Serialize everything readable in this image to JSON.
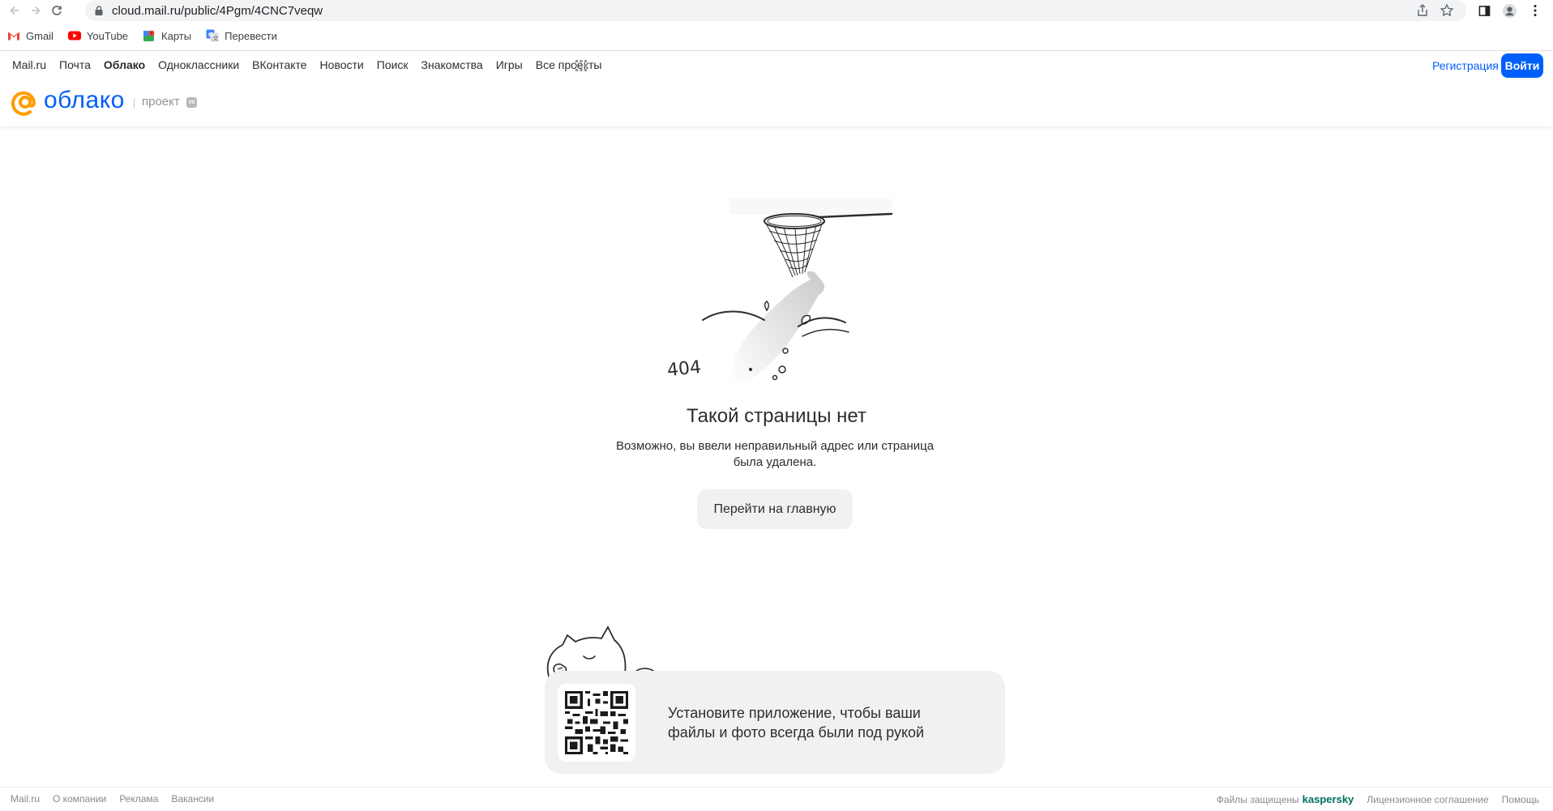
{
  "browser": {
    "url": "cloud.mail.ru/public/4Pgm/4CNC7veqw",
    "bookmarks": [
      {
        "label": "Gmail",
        "icon": "gmail-icon"
      },
      {
        "label": "YouTube",
        "icon": "youtube-icon"
      },
      {
        "label": "Карты",
        "icon": "maps-icon"
      },
      {
        "label": "Перевести",
        "icon": "translate-icon"
      }
    ]
  },
  "portal": {
    "links": [
      "Mail.ru",
      "Почта",
      "Облако",
      "Одноклассники",
      "ВКонтакте",
      "Новости",
      "Поиск",
      "Знакомства",
      "Игры",
      "Все проекты"
    ],
    "active": "Облако",
    "register_label": "Регистрация",
    "login_label": "Войти"
  },
  "cloud_header": {
    "logo_text": "облако",
    "project_label": "проект",
    "vk_badge": "VK"
  },
  "error": {
    "code_label": "404",
    "title": "Такой страницы нет",
    "description": "Возможно, вы ввели неправильный адрес или страница была удалена.",
    "home_button": "Перейти на главную"
  },
  "promo": {
    "text": "Установите приложение, чтобы ваши файлы и фото всегда были под рукой"
  },
  "footer": {
    "left_links": [
      "Mail.ru",
      "О компании",
      "Реклама",
      "Вакансии"
    ],
    "protected_label": "Файлы защищены",
    "kaspersky": "kaspersky",
    "license_label": "Лицензионное соглашение",
    "help_label": "Помощь"
  },
  "colors": {
    "accent": "#005ff9",
    "logo_orange": "#ff9e00",
    "kaspersky_green": "#006d5c"
  }
}
